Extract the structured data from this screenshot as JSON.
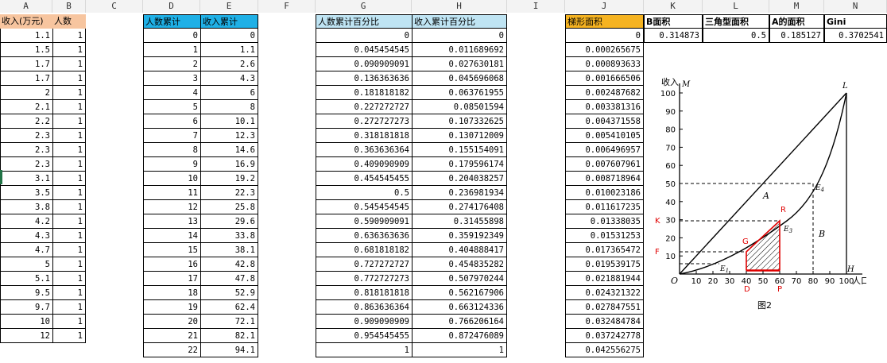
{
  "columns": [
    "A",
    "B",
    "C",
    "D",
    "E",
    "F",
    "G",
    "H",
    "I",
    "J",
    "K",
    "L",
    "M",
    "N"
  ],
  "col_ab": {
    "header_a": "收入(万元)",
    "header_b": "人数",
    "income": [
      "1.1",
      "1.5",
      "1.7",
      "1.7",
      "2",
      "2.1",
      "2.2",
      "2.3",
      "2.3",
      "2.3",
      "3.1",
      "3.5",
      "3.8",
      "4.2",
      "4.3",
      "4.7",
      "5",
      "5.1",
      "9.5",
      "9.7",
      "10",
      "12"
    ],
    "count": [
      "1",
      "1",
      "1",
      "1",
      "1",
      "1",
      "1",
      "1",
      "1",
      "1",
      "1",
      "1",
      "1",
      "1",
      "1",
      "1",
      "1",
      "1",
      "1",
      "1",
      "1",
      "1"
    ]
  },
  "col_de": {
    "header_d": "人数累计",
    "header_e": "收入累计",
    "people_cum": [
      "0",
      "1",
      "2",
      "3",
      "4",
      "5",
      "6",
      "7",
      "8",
      "9",
      "10",
      "11",
      "12",
      "13",
      "14",
      "15",
      "16",
      "17",
      "18",
      "19",
      "20",
      "21",
      "22"
    ],
    "income_cum": [
      "0",
      "1.1",
      "2.6",
      "4.3",
      "6",
      "8",
      "10.1",
      "12.3",
      "14.6",
      "16.9",
      "19.2",
      "22.3",
      "25.8",
      "29.6",
      "33.8",
      "38.1",
      "42.8",
      "47.8",
      "52.9",
      "62.4",
      "72.1",
      "82.1",
      "94.1"
    ]
  },
  "col_gh": {
    "header_g": "人数累计百分比",
    "header_h": "收入累计百分比",
    "people_pct": [
      "0",
      "0.045454545",
      "0.090909091",
      "0.136363636",
      "0.181818182",
      "0.227272727",
      "0.272727273",
      "0.318181818",
      "0.363636364",
      "0.409090909",
      "0.454545455",
      "0.5",
      "0.545454545",
      "0.590909091",
      "0.636363636",
      "0.681818182",
      "0.727272727",
      "0.772727273",
      "0.818181818",
      "0.863636364",
      "0.909090909",
      "0.954545455",
      "1"
    ],
    "income_pct": [
      "0",
      "0.011689692",
      "0.027630181",
      "0.045696068",
      "0.063761955",
      "0.08501594",
      "0.107332625",
      "0.130712009",
      "0.155154091",
      "0.179596174",
      "0.204038257",
      "0.236981934",
      "0.274176408",
      "0.31455898",
      "0.359192349",
      "0.404888417",
      "0.454835282",
      "0.507970244",
      "0.562167906",
      "0.663124336",
      "0.766206164",
      "0.872476089",
      "1"
    ]
  },
  "col_j": {
    "header": "梯形面积",
    "areas": [
      "0",
      "0.000265675",
      "0.000893633",
      "0.001666506",
      "0.002487682",
      "0.003381316",
      "0.004371558",
      "0.005410105",
      "0.006496957",
      "0.007607961",
      "0.008718964",
      "0.010023186",
      "0.011617235",
      "0.01338035",
      "0.01531253",
      "0.017365472",
      "0.019539175",
      "0.021881944",
      "0.024321322",
      "0.027847551",
      "0.032484784",
      "0.037242778",
      "0.042556275"
    ]
  },
  "col_kn": {
    "headers": [
      "B面积",
      "三角型面积",
      "A的面积",
      "Gini"
    ],
    "values": [
      "0.314873",
      "0.5",
      "0.185127",
      "0.3702541"
    ]
  },
  "figure": {
    "y_title": "收入",
    "x_title": "人口",
    "y_ticks": [
      "100",
      "90",
      "80",
      "70",
      "60",
      "50",
      "40",
      "30",
      "20",
      "10"
    ],
    "x_ticks": [
      "10",
      "20",
      "30",
      "40",
      "50",
      "60",
      "70",
      "80",
      "90",
      "100"
    ],
    "origin": "O",
    "label_M": "M",
    "label_L": "L",
    "label_H": "H",
    "label_E1": "E",
    "label_E1_sub": "1",
    "label_E3": "E",
    "label_E3_sub": "3",
    "label_E4": "E",
    "label_E4_sub": "4",
    "label_A": "A",
    "label_B": "B",
    "red_K": "K",
    "red_F": "F",
    "red_R": "R",
    "red_G": "G",
    "red_D": "D",
    "red_P": "P",
    "caption": "图2",
    "colors": {
      "red": "#e00000",
      "line": "#000000"
    }
  }
}
